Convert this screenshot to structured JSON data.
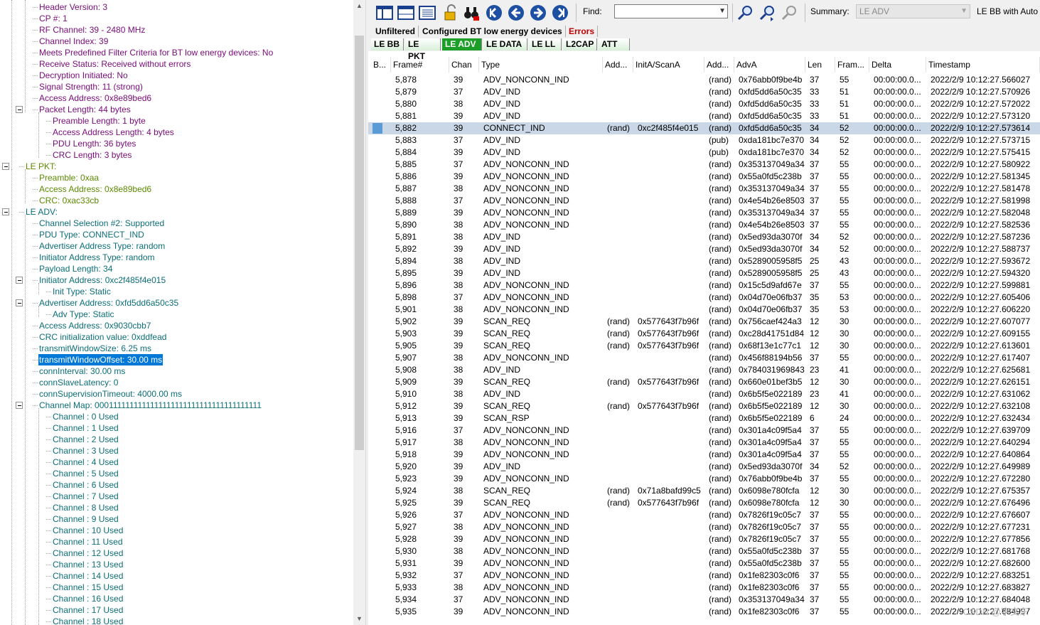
{
  "tree": {
    "rows": [
      {
        "label": "Header Version: 3",
        "depth": 2,
        "color": "purple"
      },
      {
        "label": "CP #: 1",
        "depth": 2,
        "color": "purple"
      },
      {
        "label": "RF Channel: 39 - 2480 MHz",
        "depth": 2,
        "color": "purple"
      },
      {
        "label": "Channel Index: 39",
        "depth": 2,
        "color": "purple"
      },
      {
        "label": "Meets Predefined Filter Criteria for BT low energy devices: No",
        "depth": 2,
        "color": "purple"
      },
      {
        "label": "Receive Status: Received without errors",
        "depth": 2,
        "color": "purple"
      },
      {
        "label": "Decryption Initiated: No",
        "depth": 2,
        "color": "purple"
      },
      {
        "label": "Signal Strength: 11 (strong)",
        "depth": 2,
        "color": "purple"
      },
      {
        "label": "Access Address: 0x8e89bed6",
        "depth": 2,
        "color": "purple"
      },
      {
        "label": "Packet Length: 44  bytes",
        "depth": 2,
        "color": "purple",
        "toggle": true
      },
      {
        "label": "Preamble Length: 1 byte",
        "depth": 3,
        "color": "purple"
      },
      {
        "label": "Access Address Length: 4 bytes",
        "depth": 3,
        "color": "purple"
      },
      {
        "label": "PDU Length: 36 bytes",
        "depth": 3,
        "color": "purple"
      },
      {
        "label": "CRC Length: 3 bytes",
        "depth": 3,
        "color": "purple"
      },
      {
        "label": "LE PKT:",
        "depth": 1,
        "color": "green",
        "toggle": true
      },
      {
        "label": "Preamble: 0xaa",
        "depth": 2,
        "color": "green"
      },
      {
        "label": "Access Address: 0x8e89bed6",
        "depth": 2,
        "color": "green"
      },
      {
        "label": "CRC: 0xac33cb",
        "depth": 2,
        "color": "green"
      },
      {
        "label": "LE ADV:",
        "depth": 1,
        "color": "teal",
        "toggle": true
      },
      {
        "label": "Channel Selection #2: Supported",
        "depth": 2,
        "color": "teal"
      },
      {
        "label": "PDU Type: CONNECT_IND",
        "depth": 2,
        "color": "teal"
      },
      {
        "label": "Advertiser Address Type: random",
        "depth": 2,
        "color": "teal"
      },
      {
        "label": "Initiator Address Type: random",
        "depth": 2,
        "color": "teal"
      },
      {
        "label": "Payload Length: 34",
        "depth": 2,
        "color": "teal"
      },
      {
        "label": "Initiator Address: 0xc2f485f4e015",
        "depth": 2,
        "color": "teal",
        "toggle": true
      },
      {
        "label": "Init Type: Static",
        "depth": 3,
        "color": "teal"
      },
      {
        "label": "Advertiser Address: 0xfd5dd6a50c35",
        "depth": 2,
        "color": "teal",
        "toggle": true
      },
      {
        "label": "Adv Type: Static",
        "depth": 3,
        "color": "teal"
      },
      {
        "label": "Access Address: 0x9030cbb7",
        "depth": 2,
        "color": "teal"
      },
      {
        "label": "CRC initialization value: 0xddfead",
        "depth": 2,
        "color": "teal"
      },
      {
        "label": "transmitWindowSize: 6.25  ms",
        "depth": 2,
        "color": "teal"
      },
      {
        "label": "transmitWindowOffset: 30.00  ms",
        "depth": 2,
        "color": "teal",
        "selected": true
      },
      {
        "label": "connInterval: 30.00  ms",
        "depth": 2,
        "color": "teal"
      },
      {
        "label": "connSlaveLatency: 0",
        "depth": 2,
        "color": "teal"
      },
      {
        "label": "connSupervisionTimeout: 4000.00  ms",
        "depth": 2,
        "color": "teal"
      },
      {
        "label": "Channel Map: 0001111111111111111111111111111111111111",
        "depth": 2,
        "color": "teal",
        "toggle": true
      },
      {
        "label": "Channel : 0 Used",
        "depth": 3,
        "color": "teal"
      },
      {
        "label": "Channel : 1 Used",
        "depth": 3,
        "color": "teal"
      },
      {
        "label": "Channel : 2 Used",
        "depth": 3,
        "color": "teal"
      },
      {
        "label": "Channel : 3 Used",
        "depth": 3,
        "color": "teal"
      },
      {
        "label": "Channel : 4 Used",
        "depth": 3,
        "color": "teal"
      },
      {
        "label": "Channel : 5 Used",
        "depth": 3,
        "color": "teal"
      },
      {
        "label": "Channel : 6 Used",
        "depth": 3,
        "color": "teal"
      },
      {
        "label": "Channel : 7 Used",
        "depth": 3,
        "color": "teal"
      },
      {
        "label": "Channel : 8 Used",
        "depth": 3,
        "color": "teal"
      },
      {
        "label": "Channel : 9 Used",
        "depth": 3,
        "color": "teal"
      },
      {
        "label": "Channel : 10 Used",
        "depth": 3,
        "color": "teal"
      },
      {
        "label": "Channel : 11 Used",
        "depth": 3,
        "color": "teal"
      },
      {
        "label": "Channel : 12 Used",
        "depth": 3,
        "color": "teal"
      },
      {
        "label": "Channel : 13 Used",
        "depth": 3,
        "color": "teal"
      },
      {
        "label": "Channel : 14 Used",
        "depth": 3,
        "color": "teal"
      },
      {
        "label": "Channel : 15 Used",
        "depth": 3,
        "color": "teal"
      },
      {
        "label": "Channel : 16 Used",
        "depth": 3,
        "color": "teal"
      },
      {
        "label": "Channel : 17 Used",
        "depth": 3,
        "color": "teal"
      },
      {
        "label": "Channel : 18 Used",
        "depth": 3,
        "color": "teal"
      }
    ]
  },
  "colors": {
    "purple": "#7a0b7a",
    "green": "#5c8a00",
    "teal": "#0b6e78",
    "selection": "#0078d7",
    "row_selection": "#c9d7e6",
    "active_tab": "#1c9e28",
    "errors_tab": "#c00000"
  },
  "toolbar": {
    "buttons": [
      {
        "name": "pane-layout-1-icon"
      },
      {
        "name": "pane-layout-2-icon"
      },
      {
        "name": "pane-layout-3-icon"
      },
      {
        "name": "unlock-icon"
      },
      {
        "name": "binoculars-icon"
      },
      {
        "name": "first-frame-icon"
      },
      {
        "name": "previous-frame-icon"
      },
      {
        "name": "next-frame-icon"
      },
      {
        "name": "last-frame-icon"
      }
    ],
    "find_label": "Find:",
    "find_value": "",
    "search_buttons": [
      {
        "name": "find-previous-icon"
      },
      {
        "name": "find-next-icon"
      },
      {
        "name": "find-clear-icon"
      }
    ],
    "summary_label": "Summary:",
    "summary_value": "LE ADV",
    "summary_extra": "LE BB with Auto"
  },
  "filter_tabs": [
    {
      "label": "Unfiltered"
    },
    {
      "label": "Configured BT low energy devices"
    },
    {
      "label": "Errors"
    }
  ],
  "protocol_tabs": [
    {
      "label": "LE BB"
    },
    {
      "label": "LE PKT"
    },
    {
      "label": "LE ADV",
      "active": true
    },
    {
      "label": "LE DATA"
    },
    {
      "label": "LE LL"
    },
    {
      "label": "L2CAP"
    },
    {
      "label": "ATT"
    }
  ],
  "grid": {
    "columns": [
      "B...",
      "Frame#",
      "Chan",
      "Type",
      "Add...",
      "InitA/ScanA",
      "Add...",
      "AdvA",
      "Len",
      "Fram...",
      "Delta",
      "Timestamp"
    ],
    "rows": [
      [
        "",
        "5,878",
        "39",
        "ADV_NONCONN_IND",
        "",
        "",
        "(rand)",
        "0x76abb0f9be4b",
        "37",
        "55",
        "00:00:00.0...",
        "2022/2/9 10:12:27.566027"
      ],
      [
        "",
        "5,879",
        "37",
        "ADV_IND",
        "",
        "",
        "(rand)",
        "0xfd5dd6a50c35",
        "33",
        "51",
        "00:00:00.0...",
        "2022/2/9 10:12:27.570926"
      ],
      [
        "",
        "5,880",
        "38",
        "ADV_IND",
        "",
        "",
        "(rand)",
        "0xfd5dd6a50c35",
        "33",
        "51",
        "00:00:00.0...",
        "2022/2/9 10:12:27.572022"
      ],
      [
        "",
        "5,881",
        "39",
        "ADV_IND",
        "",
        "",
        "(rand)",
        "0xfd5dd6a50c35",
        "33",
        "51",
        "00:00:00.0...",
        "2022/2/9 10:12:27.573120"
      ],
      [
        "",
        "5,882",
        "39",
        "CONNECT_IND",
        "(rand)",
        "0xc2f485f4e015",
        "(rand)",
        "0xfd5dd6a50c35",
        "34",
        "52",
        "00:00:00.0...",
        "2022/2/9 10:12:27.573614"
      ],
      [
        "",
        "5,883",
        "37",
        "ADV_IND",
        "",
        "",
        "(pub)",
        "0xda181bc7e370",
        "34",
        "52",
        "00:00:00.0...",
        "2022/2/9 10:12:27.573715"
      ],
      [
        "",
        "5,884",
        "39",
        "ADV_IND",
        "",
        "",
        "(pub)",
        "0xda181bc7e370",
        "34",
        "52",
        "00:00:00.0...",
        "2022/2/9 10:12:27.575415"
      ],
      [
        "",
        "5,885",
        "37",
        "ADV_NONCONN_IND",
        "",
        "",
        "(rand)",
        "0x353137049a34",
        "37",
        "55",
        "00:00:00.0...",
        "2022/2/9 10:12:27.580922"
      ],
      [
        "",
        "5,886",
        "39",
        "ADV_NONCONN_IND",
        "",
        "",
        "(rand)",
        "0x55a0fd5c238b",
        "37",
        "55",
        "00:00:00.0...",
        "2022/2/9 10:12:27.581345"
      ],
      [
        "",
        "5,887",
        "38",
        "ADV_NONCONN_IND",
        "",
        "",
        "(rand)",
        "0x353137049a34",
        "37",
        "55",
        "00:00:00.0...",
        "2022/2/9 10:12:27.581478"
      ],
      [
        "",
        "5,888",
        "37",
        "ADV_NONCONN_IND",
        "",
        "",
        "(rand)",
        "0x4e54b26e8503",
        "37",
        "55",
        "00:00:00.0...",
        "2022/2/9 10:12:27.581998"
      ],
      [
        "",
        "5,889",
        "39",
        "ADV_NONCONN_IND",
        "",
        "",
        "(rand)",
        "0x353137049a34",
        "37",
        "55",
        "00:00:00.0...",
        "2022/2/9 10:12:27.582048"
      ],
      [
        "",
        "5,890",
        "38",
        "ADV_NONCONN_IND",
        "",
        "",
        "(rand)",
        "0x4e54b26e8503",
        "37",
        "55",
        "00:00:00.0...",
        "2022/2/9 10:12:27.582536"
      ],
      [
        "",
        "5,891",
        "38",
        "ADV_IND",
        "",
        "",
        "(rand)",
        "0x5ed93da3070f",
        "34",
        "52",
        "00:00:00.0...",
        "2022/2/9 10:12:27.587236"
      ],
      [
        "",
        "5,892",
        "39",
        "ADV_IND",
        "",
        "",
        "(rand)",
        "0x5ed93da3070f",
        "34",
        "52",
        "00:00:00.0...",
        "2022/2/9 10:12:27.588737"
      ],
      [
        "",
        "5,894",
        "38",
        "ADV_IND",
        "",
        "",
        "(rand)",
        "0x5289005958f5",
        "25",
        "43",
        "00:00:00.0...",
        "2022/2/9 10:12:27.593672"
      ],
      [
        "",
        "5,895",
        "39",
        "ADV_IND",
        "",
        "",
        "(rand)",
        "0x5289005958f5",
        "25",
        "43",
        "00:00:00.0...",
        "2022/2/9 10:12:27.594320"
      ],
      [
        "",
        "5,896",
        "38",
        "ADV_NONCONN_IND",
        "",
        "",
        "(rand)",
        "0x15c5d9afd67e",
        "37",
        "55",
        "00:00:00.0...",
        "2022/2/9 10:12:27.599881"
      ],
      [
        "",
        "5,898",
        "37",
        "ADV_NONCONN_IND",
        "",
        "",
        "(rand)",
        "0x04d70e06fb37",
        "35",
        "53",
        "00:00:00.0...",
        "2022/2/9 10:12:27.605406"
      ],
      [
        "",
        "5,901",
        "38",
        "ADV_NONCONN_IND",
        "",
        "",
        "(rand)",
        "0x04d70e06fb37",
        "35",
        "53",
        "00:00:00.0...",
        "2022/2/9 10:12:27.606220"
      ],
      [
        "",
        "5,902",
        "39",
        "SCAN_REQ",
        "(rand)",
        "0x577643f7b96f",
        "(rand)",
        "0x756caef424a3",
        "12",
        "30",
        "00:00:00.0...",
        "2022/2/9 10:12:27.607077"
      ],
      [
        "",
        "5,903",
        "39",
        "SCAN_REQ",
        "(rand)",
        "0x577643f7b96f",
        "(rand)",
        "0xc28d41751d84",
        "12",
        "30",
        "00:00:00.0...",
        "2022/2/9 10:12:27.609155"
      ],
      [
        "",
        "5,905",
        "39",
        "SCAN_REQ",
        "(rand)",
        "0x577643f7b96f",
        "(rand)",
        "0x68f13e1c77c1",
        "12",
        "30",
        "00:00:00.0...",
        "2022/2/9 10:12:27.613601"
      ],
      [
        "",
        "5,907",
        "38",
        "ADV_NONCONN_IND",
        "",
        "",
        "(rand)",
        "0x456f88194b56",
        "37",
        "55",
        "00:00:00.0...",
        "2022/2/9 10:12:27.617407"
      ],
      [
        "",
        "5,908",
        "38",
        "ADV_IND",
        "",
        "",
        "(rand)",
        "0x784031969843",
        "23",
        "41",
        "00:00:00.0...",
        "2022/2/9 10:12:27.625681"
      ],
      [
        "",
        "5,909",
        "39",
        "SCAN_REQ",
        "(rand)",
        "0x577643f7b96f",
        "(rand)",
        "0x660e01bef3b5",
        "12",
        "30",
        "00:00:00.0...",
        "2022/2/9 10:12:27.626151"
      ],
      [
        "",
        "5,910",
        "38",
        "ADV_IND",
        "",
        "",
        "(rand)",
        "0x6b5f5e022189",
        "23",
        "41",
        "00:00:00.0...",
        "2022/2/9 10:12:27.631062"
      ],
      [
        "",
        "5,912",
        "39",
        "SCAN_REQ",
        "(rand)",
        "0x577643f7b96f",
        "(rand)",
        "0x6b5f5e022189",
        "12",
        "30",
        "00:00:00.0...",
        "2022/2/9 10:12:27.632108"
      ],
      [
        "",
        "5,913",
        "39",
        "SCAN_RSP",
        "",
        "",
        "(rand)",
        "0x6b5f5e022189",
        "6",
        "24",
        "00:00:00.0...",
        "2022/2/9 10:12:27.632434"
      ],
      [
        "",
        "5,916",
        "37",
        "ADV_NONCONN_IND",
        "",
        "",
        "(rand)",
        "0x301a4c09f5a4",
        "37",
        "55",
        "00:00:00.0...",
        "2022/2/9 10:12:27.639709"
      ],
      [
        "",
        "5,917",
        "38",
        "ADV_NONCONN_IND",
        "",
        "",
        "(rand)",
        "0x301a4c09f5a4",
        "37",
        "55",
        "00:00:00.0...",
        "2022/2/9 10:12:27.640294"
      ],
      [
        "",
        "5,918",
        "39",
        "ADV_NONCONN_IND",
        "",
        "",
        "(rand)",
        "0x301a4c09f5a4",
        "37",
        "55",
        "00:00:00.0...",
        "2022/2/9 10:12:27.640864"
      ],
      [
        "",
        "5,920",
        "39",
        "ADV_IND",
        "",
        "",
        "(rand)",
        "0x5ed93da3070f",
        "34",
        "52",
        "00:00:00.0...",
        "2022/2/9 10:12:27.649989"
      ],
      [
        "",
        "5,923",
        "39",
        "ADV_NONCONN_IND",
        "",
        "",
        "(rand)",
        "0x76abb0f9be4b",
        "37",
        "55",
        "00:00:00.0...",
        "2022/2/9 10:12:27.672280"
      ],
      [
        "",
        "5,924",
        "38",
        "SCAN_REQ",
        "(rand)",
        "0x71a8bafd99c5",
        "(rand)",
        "0x6098e780fcfa",
        "12",
        "30",
        "00:00:00.0...",
        "2022/2/9 10:12:27.675357"
      ],
      [
        "",
        "5,925",
        "39",
        "SCAN_REQ",
        "(rand)",
        "0x577643f7b96f",
        "(rand)",
        "0x6098e780fcfa",
        "12",
        "30",
        "00:00:00.0...",
        "2022/2/9 10:12:27.676496"
      ],
      [
        "",
        "5,926",
        "37",
        "ADV_NONCONN_IND",
        "",
        "",
        "(rand)",
        "0x7826f19c05c7",
        "37",
        "55",
        "00:00:00.0...",
        "2022/2/9 10:12:27.676607"
      ],
      [
        "",
        "5,927",
        "38",
        "ADV_NONCONN_IND",
        "",
        "",
        "(rand)",
        "0x7826f19c05c7",
        "37",
        "55",
        "00:00:00.0...",
        "2022/2/9 10:12:27.677231"
      ],
      [
        "",
        "5,928",
        "39",
        "ADV_NONCONN_IND",
        "",
        "",
        "(rand)",
        "0x7826f19c05c7",
        "37",
        "55",
        "00:00:00.0...",
        "2022/2/9 10:12:27.677856"
      ],
      [
        "",
        "5,930",
        "38",
        "ADV_NONCONN_IND",
        "",
        "",
        "(rand)",
        "0x55a0fd5c238b",
        "37",
        "55",
        "00:00:00.0...",
        "2022/2/9 10:12:27.681768"
      ],
      [
        "",
        "5,931",
        "39",
        "ADV_NONCONN_IND",
        "",
        "",
        "(rand)",
        "0x55a0fd5c238b",
        "37",
        "55",
        "00:00:00.0...",
        "2022/2/9 10:12:27.682600"
      ],
      [
        "",
        "5,932",
        "37",
        "ADV_NONCONN_IND",
        "",
        "",
        "(rand)",
        "0x1fe82303c0f6",
        "37",
        "55",
        "00:00:00.0...",
        "2022/2/9 10:12:27.683251"
      ],
      [
        "",
        "5,933",
        "38",
        "ADV_NONCONN_IND",
        "",
        "",
        "(rand)",
        "0x1fe82303c0f6",
        "37",
        "55",
        "00:00:00.0...",
        "2022/2/9 10:12:27.683827"
      ],
      [
        "",
        "5,934",
        "37",
        "ADV_NONCONN_IND",
        "",
        "",
        "(rand)",
        "0x353137049a34",
        "37",
        "55",
        "00:00:00.0...",
        "2022/2/9 10:12:27.684048"
      ],
      [
        "",
        "5,935",
        "39",
        "ADV_NONCONN_IND",
        "",
        "",
        "(rand)",
        "0x1fe82303c0f6",
        "37",
        "55",
        "00:00:00.0...",
        "2022/2/9 10:12:27.684997"
      ]
    ],
    "selected_row_index": 4
  },
  "watermark": "CSDN @宇文东"
}
